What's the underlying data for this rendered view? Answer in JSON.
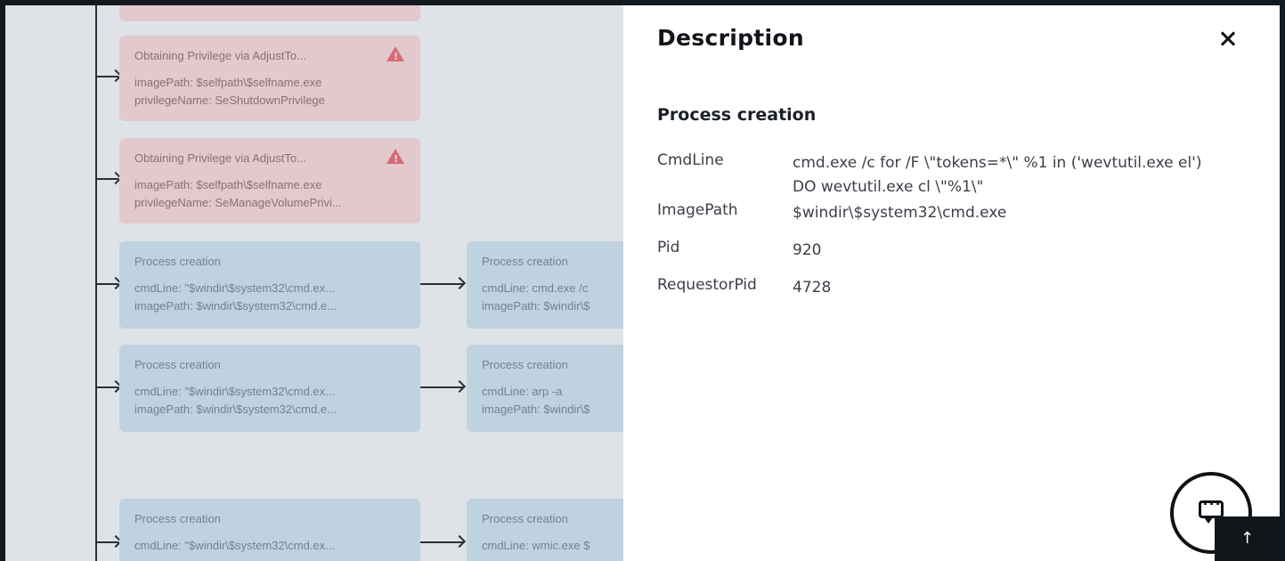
{
  "graph": {
    "nodes": [
      {
        "kind": "warn",
        "title": "Obtaining Privilege via AdjustTo...",
        "line1": "imagePath: $selfpath\\$selfname.exe",
        "line2": "privilegeName: SeShutdownPrivilege"
      },
      {
        "kind": "warn",
        "title": "Obtaining Privilege via AdjustTo...",
        "line1": "imagePath: $selfpath\\$selfname.exe",
        "line2": "privilegeName: SeManageVolumePrivi..."
      },
      {
        "kind": "proc",
        "title": "Process creation",
        "line1": "cmdLine: \"$windir\\$system32\\cmd.ex...",
        "line2": "imagePath: $windir\\$system32\\cmd.e..."
      },
      {
        "kind": "proc",
        "title": "Process creation",
        "line1": "cmdLine: cmd.exe /c",
        "line2": "imagePath: $windir\\$"
      },
      {
        "kind": "proc",
        "title": "Process creation",
        "line1": "cmdLine: \"$windir\\$system32\\cmd.ex...",
        "line2": "imagePath: $windir\\$system32\\cmd.e..."
      },
      {
        "kind": "proc",
        "title": "Process creation",
        "line1": "cmdLine: arp -a",
        "line2": "imagePath: $windir\\$"
      },
      {
        "kind": "proc",
        "title": "Process creation",
        "line1": "cmdLine: \"$windir\\$system32\\cmd.ex...",
        "line2": ""
      },
      {
        "kind": "proc",
        "title": "Process creation",
        "line1": "cmdLine: wmic.exe $",
        "line2": ""
      }
    ]
  },
  "panel": {
    "title": "Description",
    "section_title": "Process creation",
    "fields": [
      {
        "key": "CmdLine",
        "value": "cmd.exe /c for /F \\\"tokens=*\\\" %1 in ('wevtutil.exe el') DO wevtutil.exe cl \\\"%1\\\""
      },
      {
        "key": "ImagePath",
        "value": "$windir\\$system32\\cmd.exe"
      },
      {
        "key": "Pid",
        "value": "920"
      },
      {
        "key": "RequestorPid",
        "value": "4728"
      }
    ]
  },
  "controls": {
    "close_icon": "close-icon",
    "chat_icon": "chat-bubble-icon",
    "scroll_top_label": "↑"
  },
  "colors": {
    "warn_node": "#e1c9cd",
    "process_node": "#bfd2df",
    "warning_icon": "#d66a72",
    "panel_bg": "#ffffff"
  }
}
